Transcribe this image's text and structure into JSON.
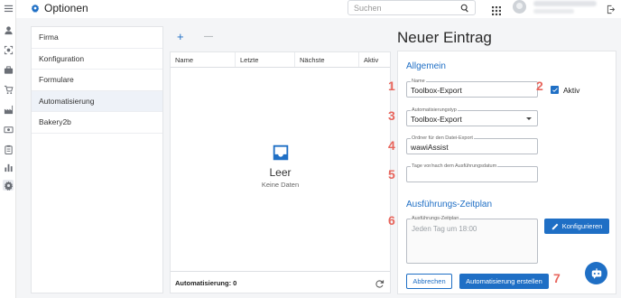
{
  "colors": {
    "accent": "#1f6fc5",
    "marker": "#e8655c"
  },
  "header": {
    "title": "Optionen",
    "search_placeholder": "Suchen"
  },
  "rail": {
    "icons": [
      "menu-icon",
      "user-icon",
      "target-icon",
      "briefcase-icon",
      "cart-icon",
      "factory-icon",
      "money-icon",
      "clipboard-icon",
      "bar-chart-icon",
      "gear-icon"
    ]
  },
  "nav": {
    "items": [
      {
        "label": "Firma"
      },
      {
        "label": "Konfiguration"
      },
      {
        "label": "Formulare"
      },
      {
        "label": "Automatisierung"
      },
      {
        "label": "Bakery2b"
      }
    ],
    "active": "Automatisierung"
  },
  "toolbar": {
    "add": "+",
    "remove": "—"
  },
  "table": {
    "columns": [
      "Name",
      "Letzte",
      "Nächste",
      "Aktiv"
    ],
    "empty_title": "Leer",
    "empty_sub": "Keine Daten",
    "footer": "Automatisierung: 0"
  },
  "form": {
    "title": "Neuer Eintrag",
    "section_general": "Allgemein",
    "name_label": "Name",
    "name_value": "Toolbox-Export",
    "active_label": "Aktiv",
    "active_checked": true,
    "type_label": "Automatisierungstyp",
    "type_value": "Toolbox-Export",
    "folder_label": "Ordner für den Datei-Export",
    "folder_value": "wawiAssist",
    "days_label": "Tage vor/nach dem Ausführungsdatum",
    "days_value": "",
    "section_schedule": "Ausführungs-Zeitplan",
    "schedule_label": "Ausführungs-Zeitplan",
    "schedule_placeholder": "Jeden Tag um 18:00",
    "configure_button": "Konfigurieren",
    "cancel_button": "Abbrechen",
    "create_button": "Automatisierung erstellen"
  },
  "markers": [
    "1",
    "2",
    "3",
    "4",
    "5",
    "6",
    "7"
  ]
}
